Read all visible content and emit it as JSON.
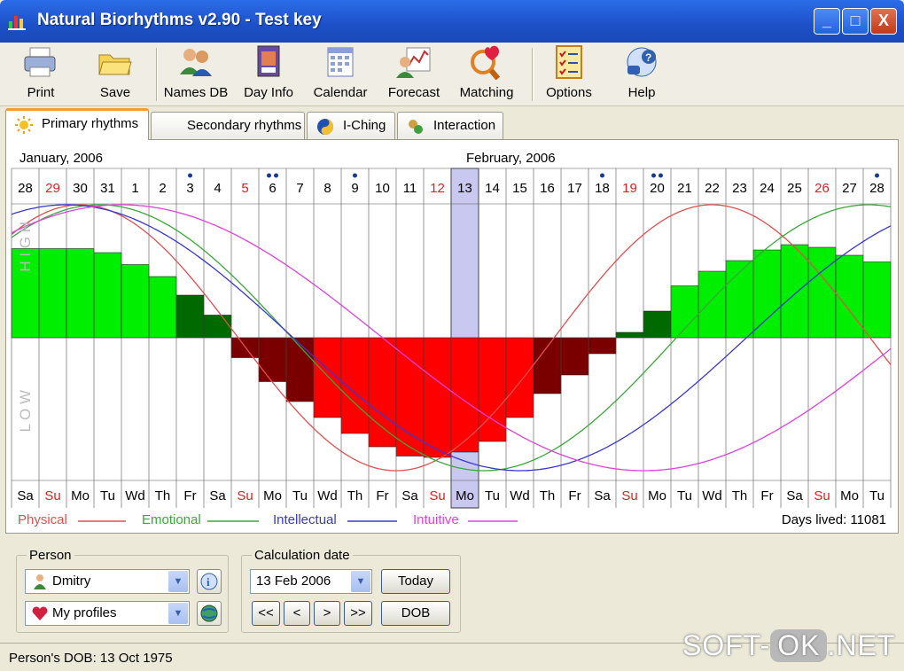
{
  "window": {
    "title": "Natural Biorhythms v2.90 - Test key",
    "minimize": "_",
    "maximize": "□",
    "close": "X"
  },
  "toolbar": [
    {
      "label": "Print",
      "icon": "printer-icon"
    },
    {
      "label": "Save",
      "icon": "folder-icon"
    },
    {
      "label": "Names DB",
      "icon": "people-icon"
    },
    {
      "label": "Day Info",
      "icon": "day-info-icon"
    },
    {
      "label": "Calendar",
      "icon": "calendar-icon"
    },
    {
      "label": "Forecast",
      "icon": "forecast-icon"
    },
    {
      "label": "Matching",
      "icon": "matching-icon"
    },
    {
      "label": "Options",
      "icon": "options-icon"
    },
    {
      "label": "Help",
      "icon": "help-icon"
    }
  ],
  "tabs": [
    {
      "label": "Primary rhythms",
      "icon": "sun-icon",
      "active": true
    },
    {
      "label": "Secondary rhythms",
      "icon": "moon-icon",
      "active": false
    },
    {
      "label": "I-Ching",
      "icon": "yin-yang-icon",
      "active": false
    },
    {
      "label": "Interaction",
      "icon": "interaction-icon",
      "active": false
    }
  ],
  "chart": {
    "month_left": "January, 2006",
    "month_right": "February, 2006",
    "high_label": "H I G H",
    "low_label": "L O W",
    "days": [
      {
        "num": "28",
        "dow": "Sa",
        "sunday": false,
        "dots": 0
      },
      {
        "num": "29",
        "dow": "Su",
        "sunday": true,
        "dots": 0
      },
      {
        "num": "30",
        "dow": "Mo",
        "sunday": false,
        "dots": 0
      },
      {
        "num": "31",
        "dow": "Tu",
        "sunday": false,
        "dots": 0
      },
      {
        "num": "1",
        "dow": "Wd",
        "sunday": false,
        "dots": 0
      },
      {
        "num": "2",
        "dow": "Th",
        "sunday": false,
        "dots": 0
      },
      {
        "num": "3",
        "dow": "Fr",
        "sunday": false,
        "dots": 1
      },
      {
        "num": "4",
        "dow": "Sa",
        "sunday": false,
        "dots": 0
      },
      {
        "num": "5",
        "dow": "Su",
        "sunday": true,
        "dots": 0
      },
      {
        "num": "6",
        "dow": "Mo",
        "sunday": false,
        "dots": 2
      },
      {
        "num": "7",
        "dow": "Tu",
        "sunday": false,
        "dots": 0
      },
      {
        "num": "8",
        "dow": "Wd",
        "sunday": false,
        "dots": 0
      },
      {
        "num": "9",
        "dow": "Th",
        "sunday": false,
        "dots": 1
      },
      {
        "num": "10",
        "dow": "Fr",
        "sunday": false,
        "dots": 0
      },
      {
        "num": "11",
        "dow": "Sa",
        "sunday": false,
        "dots": 0
      },
      {
        "num": "12",
        "dow": "Su",
        "sunday": true,
        "dots": 0
      },
      {
        "num": "13",
        "dow": "Mo",
        "sunday": false,
        "dots": 0,
        "selected": true
      },
      {
        "num": "14",
        "dow": "Tu",
        "sunday": false,
        "dots": 0
      },
      {
        "num": "15",
        "dow": "Wd",
        "sunday": false,
        "dots": 0
      },
      {
        "num": "16",
        "dow": "Th",
        "sunday": false,
        "dots": 0
      },
      {
        "num": "17",
        "dow": "Fr",
        "sunday": false,
        "dots": 0
      },
      {
        "num": "18",
        "dow": "Sa",
        "sunday": false,
        "dots": 1
      },
      {
        "num": "19",
        "dow": "Su",
        "sunday": true,
        "dots": 0
      },
      {
        "num": "20",
        "dow": "Mo",
        "sunday": false,
        "dots": 2
      },
      {
        "num": "21",
        "dow": "Tu",
        "sunday": false,
        "dots": 0
      },
      {
        "num": "22",
        "dow": "Wd",
        "sunday": false,
        "dots": 0
      },
      {
        "num": "23",
        "dow": "Th",
        "sunday": false,
        "dots": 0
      },
      {
        "num": "24",
        "dow": "Fr",
        "sunday": false,
        "dots": 0
      },
      {
        "num": "25",
        "dow": "Sa",
        "sunday": false,
        "dots": 0
      },
      {
        "num": "26",
        "dow": "Su",
        "sunday": true,
        "dots": 0
      },
      {
        "num": "27",
        "dow": "Mo",
        "sunday": false,
        "dots": 0
      },
      {
        "num": "28",
        "dow": "Tu",
        "sunday": false,
        "dots": 1
      }
    ],
    "bar_values": [
      0.67,
      0.67,
      0.67,
      0.64,
      0.55,
      0.46,
      0.32,
      0.17,
      -0.15,
      -0.33,
      -0.48,
      -0.6,
      -0.72,
      -0.82,
      -0.89,
      -0.9,
      -0.86,
      -0.78,
      -0.6,
      -0.42,
      -0.28,
      -0.12,
      0.04,
      0.2,
      0.39,
      0.5,
      0.58,
      0.66,
      0.7,
      0.68,
      0.62,
      0.57
    ],
    "colors": {
      "positive_bar": "#00ee00",
      "positive_bar_dark": "#006a00",
      "negative_bar": "#ff0000",
      "negative_bar_dark": "#7a0000",
      "physical": "#e05050",
      "emotional": "#3aa83a",
      "intellectual": "#3838d0",
      "intuitive": "#e040e0",
      "selected_column": "#c8c8f0",
      "sunday_text": "#e02020"
    }
  },
  "legend": {
    "physical": "Physical",
    "emotional": "Emotional",
    "intellectual": "Intellectual",
    "intuitive": "Intuitive",
    "days_lived": "Days lived: 11081"
  },
  "person": {
    "group_label": "Person",
    "name": "Dmitry",
    "profile": "My profiles"
  },
  "calc_date": {
    "group_label": "Calculation date",
    "value": "13 Feb 2006",
    "today": "Today",
    "dob": "DOB",
    "nav_first": "<<",
    "nav_prev": "<",
    "nav_next": ">",
    "nav_last": ">>"
  },
  "status": {
    "dob_text": "Person's DOB: 13 Oct 1975"
  },
  "watermark": {
    "prefix": "SOFT-",
    "ok": "OK",
    "suffix": ".NET"
  }
}
